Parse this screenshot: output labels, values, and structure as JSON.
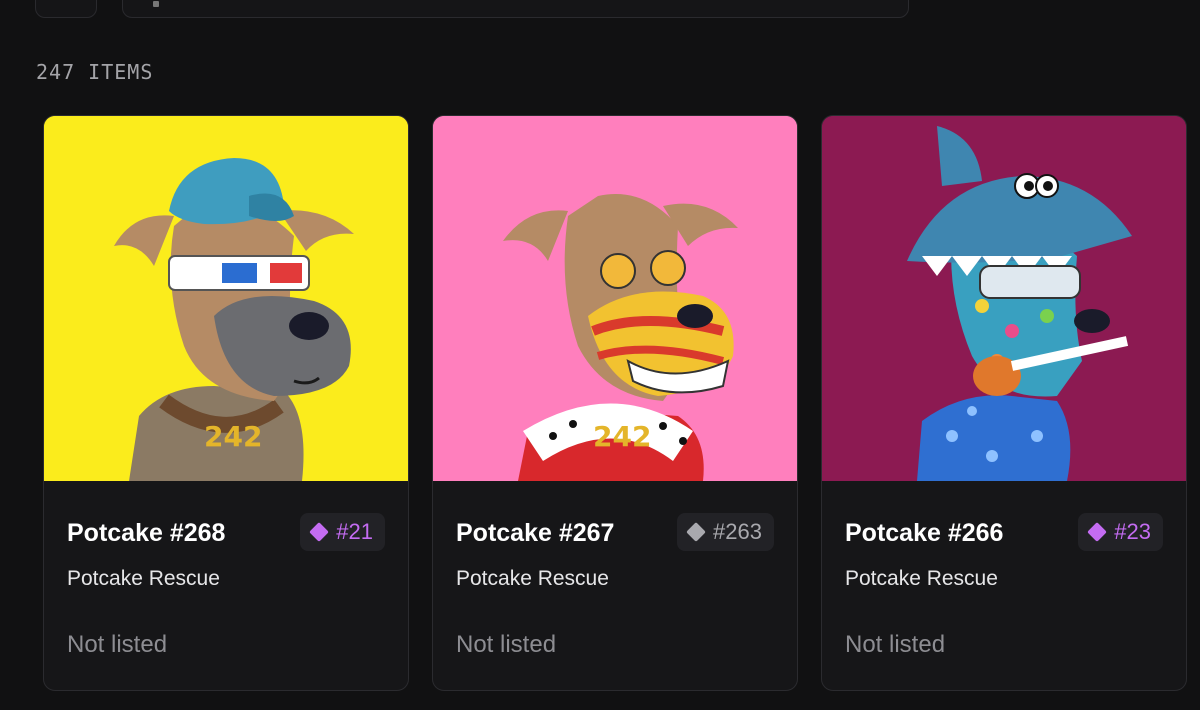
{
  "header": {
    "item_count": "247 ITEMS"
  },
  "cards": [
    {
      "title": "Potcake #268",
      "collection": "Potcake Rescue",
      "status": "Not listed",
      "rank": "#21",
      "rank_color": "#c46cf2",
      "bg_color": "#fbec1c"
    },
    {
      "title": "Potcake #267",
      "collection": "Potcake Rescue",
      "status": "Not listed",
      "rank": "#263",
      "rank_color": "#a9a9ae",
      "bg_color": "#ff7fbd"
    },
    {
      "title": "Potcake #266",
      "collection": "Potcake Rescue",
      "status": "Not listed",
      "rank": "#23",
      "rank_color": "#c46cf2",
      "bg_color": "#8c1a52"
    }
  ]
}
